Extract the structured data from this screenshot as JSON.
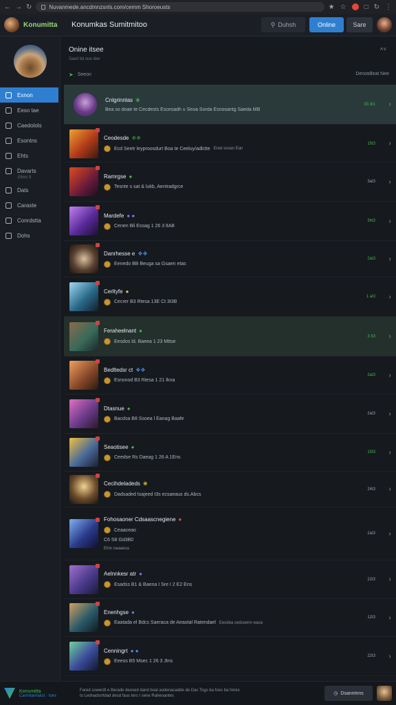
{
  "browser": {
    "url": "Nuvanmede.ancdmnzsnls.com/cemm Shoroeusts",
    "icons": [
      "back-icon",
      "forward-icon",
      "reload-icon",
      "star-icon",
      "bookmark-icon"
    ]
  },
  "header": {
    "brand": "Konumitta",
    "title": "Konumkas Sumitmitoo",
    "search_label": "Duhsh",
    "online_label": "Online",
    "store_label": "Sare"
  },
  "sidebar": {
    "items": [
      {
        "label": "Exnon",
        "active": true
      },
      {
        "label": "Eeso tae",
        "active": false
      },
      {
        "label": "Caedolols",
        "active": false
      },
      {
        "label": "Esontns",
        "active": false
      },
      {
        "label": "Ehts",
        "active": false
      },
      {
        "label": "Davarts",
        "active": false
      },
      {
        "label": "Dats",
        "active": false
      },
      {
        "label": "Caraste",
        "active": false
      },
      {
        "label": "Conrdstta",
        "active": false
      },
      {
        "label": "Dohs",
        "active": false
      }
    ],
    "note": "Gtmc 5"
  },
  "main": {
    "title": "Onine itsee",
    "subtitle": "Saed tid oue dee",
    "collapse": "˄˅",
    "filter_left": "Seeon",
    "filter_right": "Denotdleat Nee"
  },
  "rows": [
    {
      "name": "Cnlgrinnlas",
      "tag": "❀",
      "detail": "Bea so doae te Cecdests Escesadh ± Seoa Sorda Esnosantg Saeda MB",
      "status": "33 dt1",
      "status_color": "green",
      "style": "featured"
    },
    {
      "name": "Ceodesde",
      "tag": "❈❈",
      "detail": "Ecd Seetr leyproosdurt Boa te Ceeluy/adlctte",
      "extra": "Ered scoan Ean",
      "status": "15t3",
      "status_color": "green"
    },
    {
      "name": "Ramrgse",
      "tag": "●",
      "detail": "Tesnte s sat & lukb, Aentradgrce",
      "status": "3at3",
      "status_color": "grey"
    },
    {
      "name": "Mardefe",
      "tag": "● ●",
      "detail": "Cenen Bli Essag 1 26 3 ltAB",
      "status": "3ht3",
      "status_color": "green"
    },
    {
      "name": "Danrhesse e",
      "tag": "❖❖",
      "detail": "Eenedo BB Beuga sa Gsaen etas",
      "status": "2at3",
      "status_color": "green"
    },
    {
      "name": "Cerltyfe",
      "tag": "●",
      "detail": "Cecrer B3 Rtesa 13E Ct 3t3B",
      "status": "1 at3",
      "status_color": "green"
    },
    {
      "name": "Feraheelnant",
      "tag": "●",
      "detail": "Eesdos ld. Baeea 1 23 Mttse",
      "status": "3 It3",
      "status_color": "green",
      "style": "highlight"
    },
    {
      "name": "Bedltedsr ct",
      "tag": "❖❖",
      "detail": "Esnsnod B3 Riesa 1 21 Ikna",
      "status": "2at3",
      "status_color": "green"
    },
    {
      "name": "Dtasnue",
      "tag": "●",
      "detail": "Bacdsa B8 Ssoea l Eanag Baafe",
      "status": "2at3",
      "status_color": "grey"
    },
    {
      "name": "Seaotisee",
      "tag": "●",
      "detail": "Ceedse Rs Daeag 1 26 A 1Ens",
      "status": "15t3",
      "status_color": "green"
    },
    {
      "name": "Cecihdeladeds",
      "tag": "❀",
      "detail": "Dadsaded tsajeed t3s ecsaeaus ds.Abcs",
      "status": "24t3",
      "status_color": "grey"
    },
    {
      "name": "Fohosaoner Cdsaascnegiene",
      "tag": "●",
      "detail": "Ceaaceao",
      "extra": "C6 S8 Gd3B0",
      "note": "Elnn naaaeca",
      "status": "2at3",
      "status_color": "grey",
      "style": "tall"
    },
    {
      "name": "Aelnnkesr atr",
      "tag": "●",
      "detail": "Esadss B1 & Baena I Sre I 2 E2 Ens",
      "status": "22t3",
      "status_color": "grey"
    },
    {
      "name": "Enenhgse",
      "tag": "●",
      "detail": "Eaatada el Bdcs Saeraca de Aeaotal Ratendael",
      "extra": "Eecdea cedusenn eaoa",
      "status": "12t3",
      "status_color": "grey"
    },
    {
      "name": "Cenningrt",
      "tag": "● ●",
      "detail": "Eeeos B5 Msec 1 26 3 Jtns",
      "status": "22t3",
      "status_color": "grey"
    }
  ],
  "footer": {
    "brand": "Konumitta",
    "brand_sub": "Carmitanhatst · toes",
    "line1": "Fared sowerdt e Berade deosed dand boal aodenacadde de Dac Togs ba foes ba fones",
    "line2": "to Lednadsrrtdad desd faus ters t sene Raheoantes",
    "button": "Dsanntnns"
  },
  "colors": {
    "accent": "#2f7fd1",
    "online_green": "#3fb950",
    "background": "#16191e"
  }
}
